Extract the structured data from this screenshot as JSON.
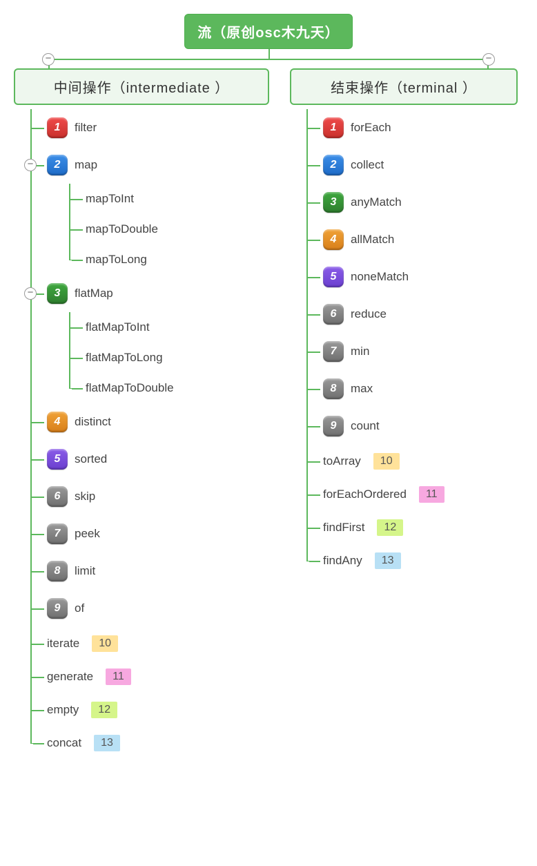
{
  "root": {
    "title": "流（原创osc木九天）"
  },
  "toggle_glyph": "−",
  "groups": {
    "intermediate": {
      "title": "中间操作（intermediate ）",
      "items": [
        {
          "num": "1",
          "label": "filter",
          "badge_color": "red"
        },
        {
          "num": "2",
          "label": "map",
          "badge_color": "blue",
          "expandable": true,
          "children": [
            {
              "label": "mapToInt"
            },
            {
              "label": "mapToDouble"
            },
            {
              "label": "mapToLong"
            }
          ]
        },
        {
          "num": "3",
          "label": "flatMap",
          "badge_color": "green",
          "expandable": true,
          "children": [
            {
              "label": "flatMapToInt"
            },
            {
              "label": "flatMapToLong"
            },
            {
              "label": "flatMapToDouble"
            }
          ]
        },
        {
          "num": "4",
          "label": "distinct",
          "badge_color": "orange"
        },
        {
          "num": "5",
          "label": "sorted",
          "badge_color": "purple"
        },
        {
          "num": "6",
          "label": "skip",
          "badge_color": "gray"
        },
        {
          "num": "7",
          "label": "peek",
          "badge_color": "gray"
        },
        {
          "num": "8",
          "label": "limit",
          "badge_color": "gray"
        },
        {
          "num": "9",
          "label": "of",
          "badge_color": "gray"
        },
        {
          "label": "iterate",
          "tag": "10",
          "tag_color": "yellow"
        },
        {
          "label": "generate",
          "tag": "11",
          "tag_color": "pink"
        },
        {
          "label": "empty",
          "tag": "12",
          "tag_color": "lime"
        },
        {
          "label": "concat",
          "tag": "13",
          "tag_color": "lightblue"
        }
      ]
    },
    "terminal": {
      "title": "结束操作（terminal ）",
      "items": [
        {
          "num": "1",
          "label": "forEach",
          "badge_color": "red"
        },
        {
          "num": "2",
          "label": "collect",
          "badge_color": "blue"
        },
        {
          "num": "3",
          "label": "anyMatch",
          "badge_color": "green"
        },
        {
          "num": "4",
          "label": "allMatch",
          "badge_color": "orange"
        },
        {
          "num": "5",
          "label": "noneMatch",
          "badge_color": "purple"
        },
        {
          "num": "6",
          "label": "reduce",
          "badge_color": "gray"
        },
        {
          "num": "7",
          "label": "min",
          "badge_color": "gray"
        },
        {
          "num": "8",
          "label": "max",
          "badge_color": "gray"
        },
        {
          "num": "9",
          "label": "count",
          "badge_color": "gray"
        },
        {
          "label": "toArray",
          "tag": "10",
          "tag_color": "yellow"
        },
        {
          "label": "forEachOrdered",
          "tag": "11",
          "tag_color": "pink"
        },
        {
          "label": "findFirst",
          "tag": "12",
          "tag_color": "lime"
        },
        {
          "label": "findAny",
          "tag": "13",
          "tag_color": "lightblue"
        }
      ]
    }
  }
}
